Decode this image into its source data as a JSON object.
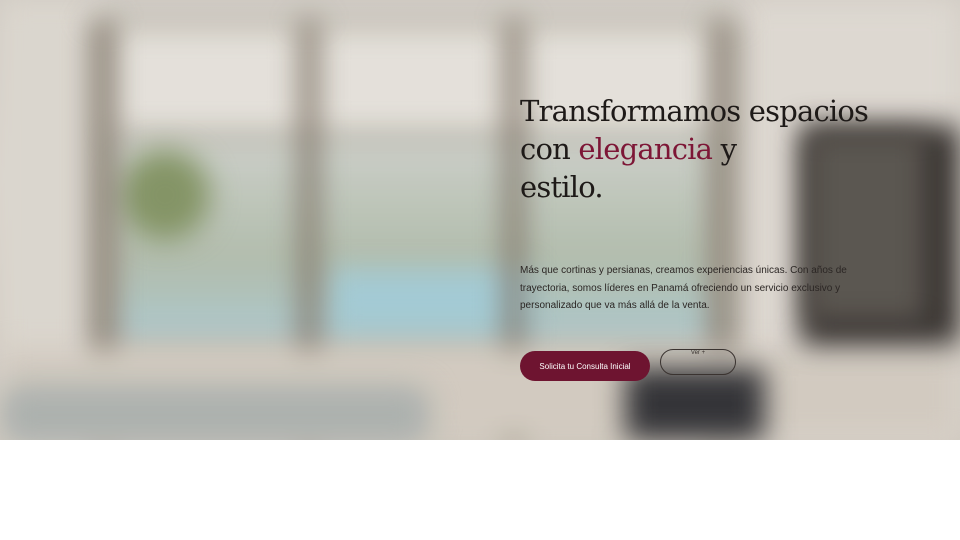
{
  "hero": {
    "headline_line1": "Transformamos espacios",
    "headline_line2_pre": "con ",
    "headline_accent": "elegancia",
    "headline_line2_post": " y",
    "headline_line3": "estilo.",
    "description": "Más que cortinas y persianas, creamos experiencias únicas. Con años de trayectoria, somos líderes en Panamá ofreciendo un servicio exclusivo y personalizado que va más allá de la venta.",
    "cta_label": "Solicita tu Consulta Inicial",
    "secondary_label": "Ver +"
  },
  "colors": {
    "accent": "#7d1636",
    "button": "#6e1430",
    "text": "#1e1a18"
  }
}
